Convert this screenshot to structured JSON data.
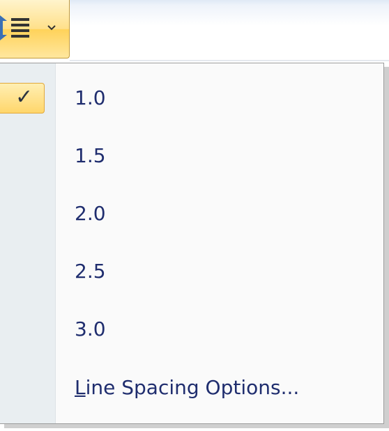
{
  "toolbar": {
    "line_spacing_button_icon": "line-spacing-icon",
    "dropdown_arrow_icon": "chevron-down-icon",
    "accent_highlight": "#ffd66b"
  },
  "menu": {
    "checked_item_index": 0,
    "check_icon": "checkmark-icon",
    "items": [
      {
        "label": "1.0"
      },
      {
        "label": "1.5"
      },
      {
        "label": "2.0"
      },
      {
        "label": "2.5"
      },
      {
        "label": "3.0"
      }
    ],
    "options": {
      "accel": "L",
      "rest": "ine Spacing Options..."
    },
    "text_color": "#1f2d6e"
  }
}
